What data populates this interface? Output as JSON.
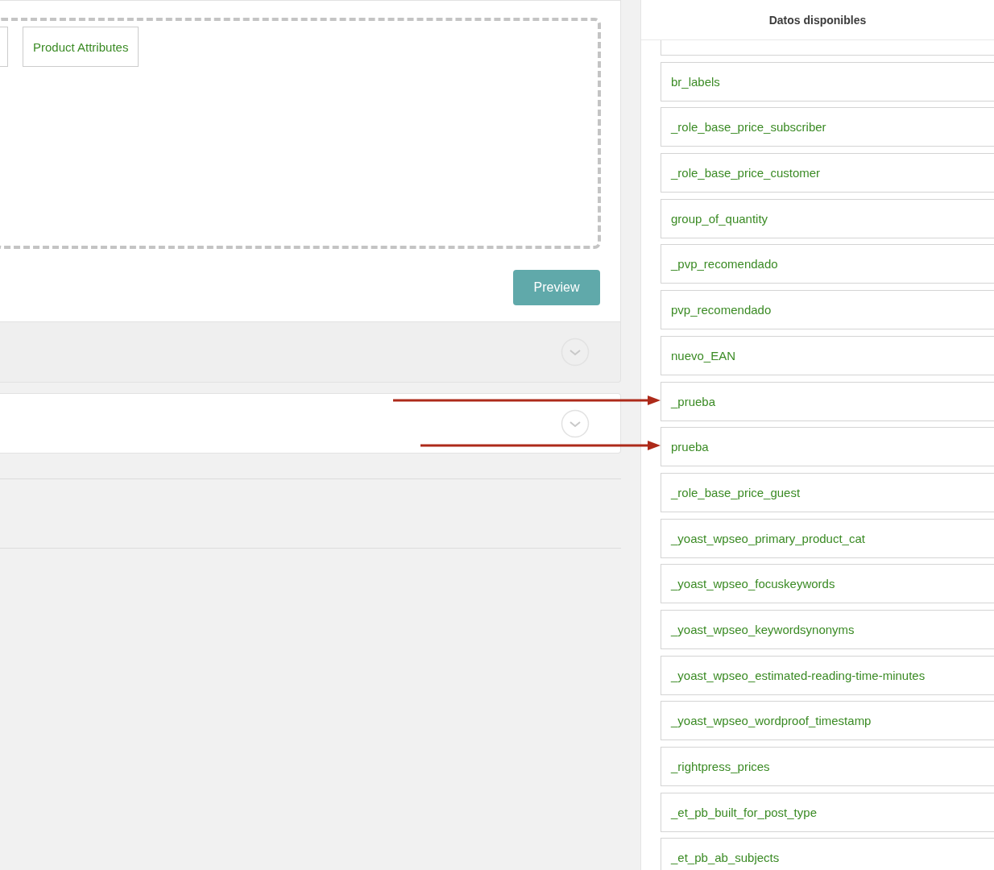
{
  "editor": {
    "buttons": [
      {
        "label": "Product Attributes"
      }
    ],
    "preview_button": "Preview"
  },
  "data_panel": {
    "title": "Datos disponibles",
    "items": [
      {
        "label": "br_labels",
        "arrow": false
      },
      {
        "label": "_role_base_price_subscriber",
        "arrow": false
      },
      {
        "label": "_role_base_price_customer",
        "arrow": false
      },
      {
        "label": "group_of_quantity",
        "arrow": false
      },
      {
        "label": "_pvp_recomendado",
        "arrow": false
      },
      {
        "label": "pvp_recomendado",
        "arrow": false
      },
      {
        "label": "nuevo_EAN",
        "arrow": false
      },
      {
        "label": "_prueba",
        "arrow": true
      },
      {
        "label": "prueba",
        "arrow": true
      },
      {
        "label": "_role_base_price_guest",
        "arrow": false
      },
      {
        "label": "_yoast_wpseo_primary_product_cat",
        "arrow": false
      },
      {
        "label": "_yoast_wpseo_focuskeywords",
        "arrow": false
      },
      {
        "label": "_yoast_wpseo_keywordsynonyms",
        "arrow": false
      },
      {
        "label": "_yoast_wpseo_estimated-reading-time-minutes",
        "arrow": false
      },
      {
        "label": "_yoast_wpseo_wordproof_timestamp",
        "arrow": false
      },
      {
        "label": "_rightpress_prices",
        "arrow": false
      },
      {
        "label": "_et_pb_built_for_post_type",
        "arrow": false
      },
      {
        "label": "_et_pb_ab_subjects",
        "arrow": false
      }
    ]
  }
}
